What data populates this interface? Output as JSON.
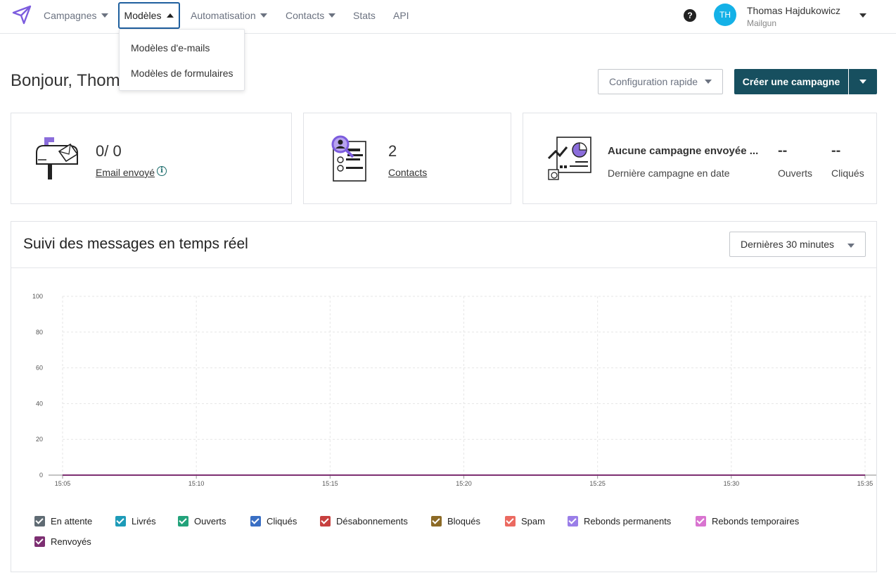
{
  "nav": {
    "items": [
      {
        "label": "Campagnes",
        "dropdown": true
      },
      {
        "label": "Modèles",
        "dropdown": true,
        "active": true
      },
      {
        "label": "Automatisation",
        "dropdown": true
      },
      {
        "label": "Contacts",
        "dropdown": true
      },
      {
        "label": "Stats",
        "dropdown": false
      },
      {
        "label": "API",
        "dropdown": false
      }
    ],
    "help_label": "?",
    "user": {
      "initials": "TH",
      "name": "Thomas Hajdukowicz",
      "org": "Mailgun"
    }
  },
  "dropdown": {
    "items": [
      "Modèles d'e-mails",
      "Modèles de formulaires"
    ]
  },
  "greeting": "Bonjour, Thom",
  "actions": {
    "config_label": "Configuration rapide",
    "create_label": "Créer une campagne"
  },
  "cards": {
    "emails": {
      "value": "0/ 0",
      "link": "Email envoyé"
    },
    "contacts": {
      "value": "2",
      "link": "Contacts"
    },
    "campaign": {
      "title": "Aucune campagne envoyée ...",
      "subtitle": "Dernière campagne en date",
      "opened_value": "--",
      "opened_label": "Ouverts",
      "clicked_value": "--",
      "clicked_label": "Cliqués"
    }
  },
  "chart_section": {
    "title": "Suivi des messages en temps réel",
    "range_label": "Dernières 30 minutes"
  },
  "chart_data": {
    "type": "line",
    "x": [
      "15:05",
      "15:10",
      "15:15",
      "15:20",
      "15:25",
      "15:30",
      "15:35"
    ],
    "ylim": [
      0,
      100
    ],
    "yticks": [
      "0",
      "20",
      "40",
      "60",
      "80",
      "100"
    ],
    "grid": true,
    "series": [
      {
        "name": "En attente",
        "color": "#5f6b73",
        "values": [
          0,
          0,
          0,
          0,
          0,
          0,
          0
        ]
      },
      {
        "name": "Livrés",
        "color": "#1e9bb8",
        "values": [
          0,
          0,
          0,
          0,
          0,
          0,
          0
        ]
      },
      {
        "name": "Ouverts",
        "color": "#23a37b",
        "values": [
          0,
          0,
          0,
          0,
          0,
          0,
          0
        ]
      },
      {
        "name": "Cliqués",
        "color": "#3a6fc4",
        "values": [
          0,
          0,
          0,
          0,
          0,
          0,
          0
        ]
      },
      {
        "name": "Désabonnements",
        "color": "#c7403f",
        "values": [
          0,
          0,
          0,
          0,
          0,
          0,
          0
        ]
      },
      {
        "name": "Bloqués",
        "color": "#8c6a26",
        "values": [
          0,
          0,
          0,
          0,
          0,
          0,
          0
        ]
      },
      {
        "name": "Spam",
        "color": "#eb6a61",
        "values": [
          0,
          0,
          0,
          0,
          0,
          0,
          0
        ]
      },
      {
        "name": "Rebonds permanents",
        "color": "#9a7ee8",
        "values": [
          0,
          0,
          0,
          0,
          0,
          0,
          0
        ]
      },
      {
        "name": "Rebonds temporaires",
        "color": "#d974d0",
        "values": [
          0,
          0,
          0,
          0,
          0,
          0,
          0
        ]
      },
      {
        "name": "Renvoyés",
        "color": "#7d2f72",
        "values": [
          0,
          0,
          0,
          0,
          0,
          0,
          0
        ]
      }
    ]
  }
}
